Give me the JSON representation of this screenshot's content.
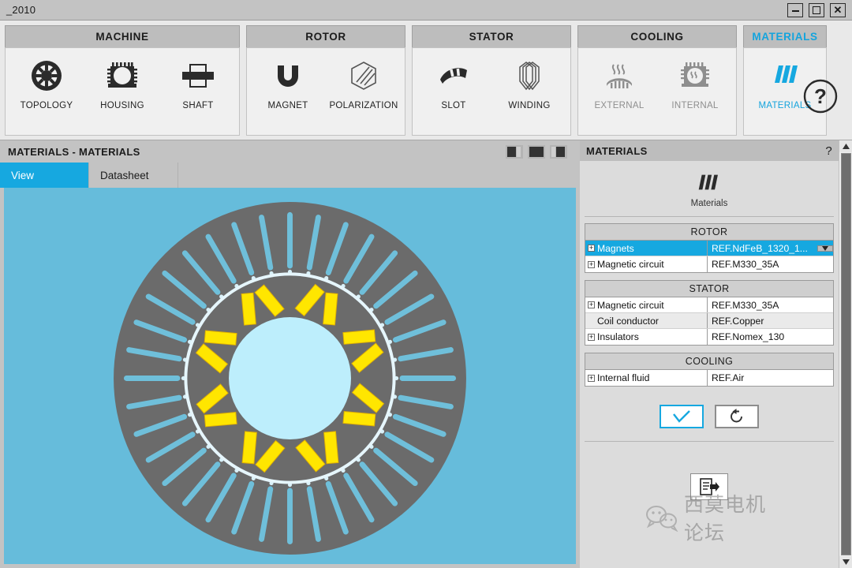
{
  "window": {
    "title": "_2010",
    "minimize_label": "minimize",
    "maximize_label": "maximize",
    "close_label": "close"
  },
  "ribbon": {
    "groups": [
      {
        "name": "MACHINE",
        "active": false,
        "items": [
          {
            "label": "TOPOLOGY",
            "icon": "topology-icon",
            "state": "enabled"
          },
          {
            "label": "HOUSING",
            "icon": "housing-icon",
            "state": "enabled"
          },
          {
            "label": "SHAFT",
            "icon": "shaft-icon",
            "state": "enabled"
          }
        ]
      },
      {
        "name": "ROTOR",
        "active": false,
        "items": [
          {
            "label": "MAGNET",
            "icon": "magnet-icon",
            "state": "enabled"
          },
          {
            "label": "POLARIZATION",
            "icon": "polarization-icon",
            "state": "enabled"
          }
        ]
      },
      {
        "name": "STATOR",
        "active": false,
        "items": [
          {
            "label": "SLOT",
            "icon": "slot-icon",
            "state": "enabled"
          },
          {
            "label": "WINDING",
            "icon": "winding-icon",
            "state": "enabled"
          }
        ]
      },
      {
        "name": "COOLING",
        "active": false,
        "items": [
          {
            "label": "EXTERNAL",
            "icon": "external-cooling-icon",
            "state": "disabled"
          },
          {
            "label": "INTERNAL",
            "icon": "internal-cooling-icon",
            "state": "disabled"
          }
        ]
      },
      {
        "name": "MATERIALS",
        "active": true,
        "items": [
          {
            "label": "MATERIALS",
            "icon": "materials-icon",
            "state": "selected"
          }
        ]
      }
    ],
    "help_label": "?"
  },
  "left_panel": {
    "title": "MATERIALS - MATERIALS",
    "layout_buttons": [
      "split-left-layout",
      "full-layout",
      "split-right-layout"
    ],
    "tabs": [
      {
        "label": "View",
        "active": true
      },
      {
        "label": "Datasheet",
        "active": false
      }
    ],
    "viewport": {
      "name": "motor-cross-section",
      "background_color": "#66bcdb",
      "stator_color": "#6b6b6b",
      "slot_color": "#6fbfda",
      "magnet_color": "#ffe600",
      "bore_color": "#bdeefc",
      "slot_count": 36,
      "pole_count": 8
    }
  },
  "right_panel": {
    "header": "MATERIALS",
    "help_label": "?",
    "logo_caption": "Materials",
    "tables": [
      {
        "title": "ROTOR",
        "rows": [
          {
            "label": "Magnets",
            "value": "REF.NdFeB_1320_1...",
            "expandable": true,
            "selected": true,
            "has_dropdown": true
          },
          {
            "label": "Magnetic circuit",
            "value": "REF.M330_35A",
            "expandable": true,
            "selected": false,
            "has_dropdown": false
          }
        ]
      },
      {
        "title": "STATOR",
        "rows": [
          {
            "label": "Magnetic circuit",
            "value": "REF.M330_35A",
            "expandable": true,
            "selected": false,
            "has_dropdown": false
          },
          {
            "label": "Coil conductor",
            "value": "REF.Copper",
            "expandable": false,
            "selected": false,
            "has_dropdown": false
          },
          {
            "label": "Insulators",
            "value": "REF.Nomex_130",
            "expandable": true,
            "selected": false,
            "has_dropdown": false
          }
        ]
      },
      {
        "title": "COOLING",
        "rows": [
          {
            "label": "Internal fluid",
            "value": "REF.Air",
            "expandable": true,
            "selected": false,
            "has_dropdown": false
          }
        ]
      }
    ],
    "actions": [
      {
        "name": "apply-button",
        "icon": "check-icon",
        "primary": true
      },
      {
        "name": "reset-button",
        "icon": "refresh-icon",
        "primary": false
      }
    ],
    "export_icon": "export-document-icon",
    "watermark_text": "西莫电机论坛"
  },
  "colors": {
    "accent": "#16a8e0",
    "ribbon_bg": "#e9e9e9",
    "panel_bg": "#dcdcdc",
    "header_bg": "#bdbdbd"
  }
}
